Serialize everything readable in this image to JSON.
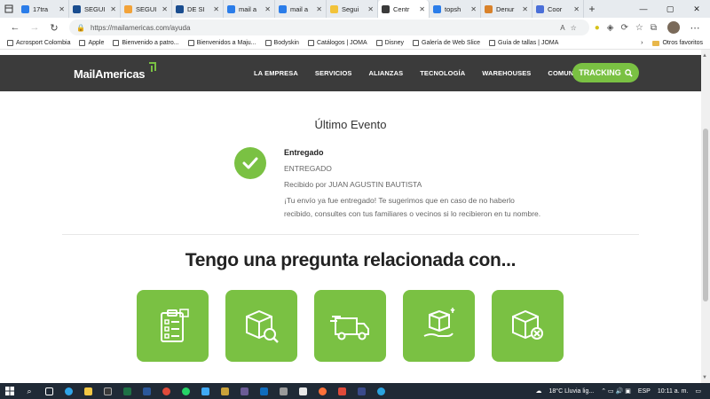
{
  "browser": {
    "tabs": [
      {
        "title": "17tra",
        "color": "#2b7de9",
        "active": false
      },
      {
        "title": "SEGUI",
        "color": "#1a4d8f",
        "active": false
      },
      {
        "title": "SEGUI",
        "color": "#f2a33a",
        "active": false
      },
      {
        "title": "DE SI",
        "color": "#1a4d8f",
        "active": false
      },
      {
        "title": "mail a",
        "color": "#2b7de9",
        "active": false
      },
      {
        "title": "mail a",
        "color": "#2b7de9",
        "active": false
      },
      {
        "title": "Segui",
        "color": "#f2c33a",
        "active": false
      },
      {
        "title": "Centr",
        "color": "#3b3b3b",
        "active": true
      },
      {
        "title": "topsh",
        "color": "#2b7de9",
        "active": false
      },
      {
        "title": "Denur",
        "color": "#d9822b",
        "active": false
      },
      {
        "title": "Coor",
        "color": "#4a6fd8",
        "active": false
      }
    ],
    "new_tab": "+",
    "window_buttons": [
      "—",
      "▢",
      "✕"
    ],
    "url": "https://mailamericas.com/ayuda",
    "bookmarks": [
      "Acrosport Colombia",
      "Apple",
      "Bienvenido a patro...",
      "Bienvenidos a Maju...",
      "Bodyskin",
      "Catálogos | JOMA",
      "Disney",
      "Galería de Web Slice",
      "Guía de tallas | JOMA"
    ],
    "bookmarks_more": "›",
    "other_favorites": "Otros favoritos"
  },
  "site": {
    "logo": "MailAmericas",
    "menu": [
      "LA EMPRESA",
      "SERVICIOS",
      "ALIANZAS",
      "TECNOLOGÍA",
      "WAREHOUSES",
      "COMUNICADOS"
    ],
    "tracking_label": "TRACKING",
    "accent": "#7ac143",
    "header_bg": "#3b3b3b"
  },
  "event": {
    "heading": "Último Evento",
    "status": "Entregado",
    "code": "ENTREGADO",
    "received_by": "Recibido por JUAN AGUSTIN BAUTISTA",
    "message_line1": "¡Tu envío ya fue entregado! Te sugerimos que en caso de no haberlo",
    "message_line2": "recibido, consultes con tus familiares o vecinos si lo recibieron en tu nombre."
  },
  "faq": {
    "title": "Tengo una pregunta relacionada con...",
    "cards": [
      {
        "icon": "clipboard-checklist-icon"
      },
      {
        "icon": "package-search-icon"
      },
      {
        "icon": "delivery-truck-icon"
      },
      {
        "icon": "package-in-hand-icon"
      },
      {
        "icon": "package-cancel-icon"
      }
    ]
  },
  "taskbar": {
    "weather": "18°C  Lluvia lig...",
    "language": "ESP",
    "time": "10:11 a. m."
  }
}
